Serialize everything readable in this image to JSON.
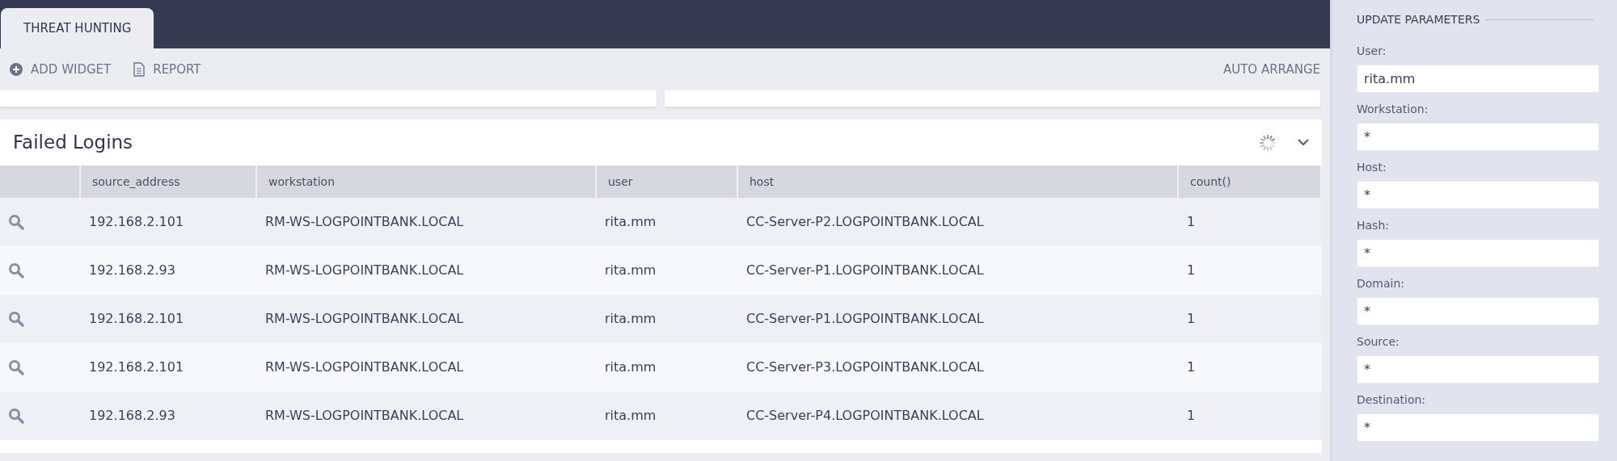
{
  "tabs": [
    {
      "label": "THREAT HUNTING",
      "selected": true
    }
  ],
  "toolbar": {
    "actions": [
      {
        "label": "ADD WIDGET",
        "kind": "add"
      },
      {
        "label": "REPORT",
        "kind": "report"
      }
    ],
    "auto_arrange": "AUTO ARRANGE"
  },
  "widget": {
    "title": "Failed Logins",
    "loading": true,
    "columns": [
      "source_address",
      "workstation",
      "user",
      "host",
      "count()"
    ],
    "rows": [
      {
        "cells": [
          "192.168.2.101",
          "RM-WS-LOGPOINTBANK.LOCAL",
          "rita.mm",
          "CC-Server-P2.LOGPOINTBANK.LOCAL",
          "1"
        ]
      },
      {
        "cells": [
          "192.168.2.93",
          "RM-WS-LOGPOINTBANK.LOCAL",
          "rita.mm",
          "CC-Server-P1.LOGPOINTBANK.LOCAL",
          "1"
        ]
      },
      {
        "cells": [
          "192.168.2.101",
          "RM-WS-LOGPOINTBANK.LOCAL",
          "rita.mm",
          "CC-Server-P1.LOGPOINTBANK.LOCAL",
          "1"
        ]
      },
      {
        "cells": [
          "192.168.2.101",
          "RM-WS-LOGPOINTBANK.LOCAL",
          "rita.mm",
          "CC-Server-P3.LOGPOINTBANK.LOCAL",
          "1"
        ]
      },
      {
        "cells": [
          "192.168.2.93",
          "RM-WS-LOGPOINTBANK.LOCAL",
          "rita.mm",
          "CC-Server-P4.LOGPOINTBANK.LOCAL",
          "1"
        ]
      }
    ]
  },
  "parameters": {
    "title": "UPDATE PARAMETERS",
    "fields": [
      {
        "label": "User:",
        "value": "rita.mm"
      },
      {
        "label": "Workstation:",
        "value": "*"
      },
      {
        "label": "Host:",
        "value": "*"
      },
      {
        "label": "Hash:",
        "value": "*"
      },
      {
        "label": "Domain:",
        "value": "*"
      },
      {
        "label": "Source:",
        "value": "*"
      },
      {
        "label": "Destination:",
        "value": "*"
      }
    ]
  }
}
